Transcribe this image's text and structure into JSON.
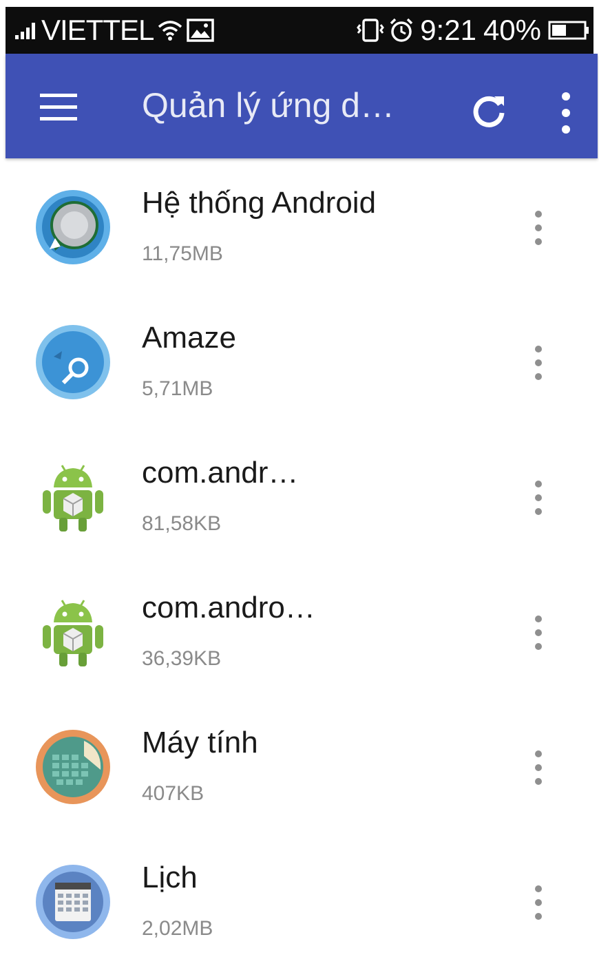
{
  "status_bar": {
    "carrier": "VIETTEL",
    "time": "9:21",
    "battery": "40%",
    "icons": [
      "signal-icon",
      "wifi-icon",
      "image-notification-icon",
      "vibrate-icon",
      "alarm-icon",
      "battery-icon"
    ]
  },
  "app_bar": {
    "title": "Quản lý ứng d…",
    "background": "#3f51b5",
    "icons": [
      "menu-icon",
      "refresh-icon",
      "more-vert-icon"
    ]
  },
  "apps": [
    {
      "name": "Hệ thống Android",
      "size": "11,75MB",
      "icon": "android-system-icon"
    },
    {
      "name": "Amaze",
      "size": "5,71MB",
      "icon": "amaze-icon"
    },
    {
      "name": "com.andr…",
      "size": "81,58KB",
      "icon": "android-robot-icon"
    },
    {
      "name": "com.andro…",
      "size": "36,39KB",
      "icon": "android-robot-icon"
    },
    {
      "name": "Máy tính",
      "size": "407KB",
      "icon": "calculator-icon"
    },
    {
      "name": "Lịch",
      "size": "2,02MB",
      "icon": "calendar-icon"
    }
  ]
}
